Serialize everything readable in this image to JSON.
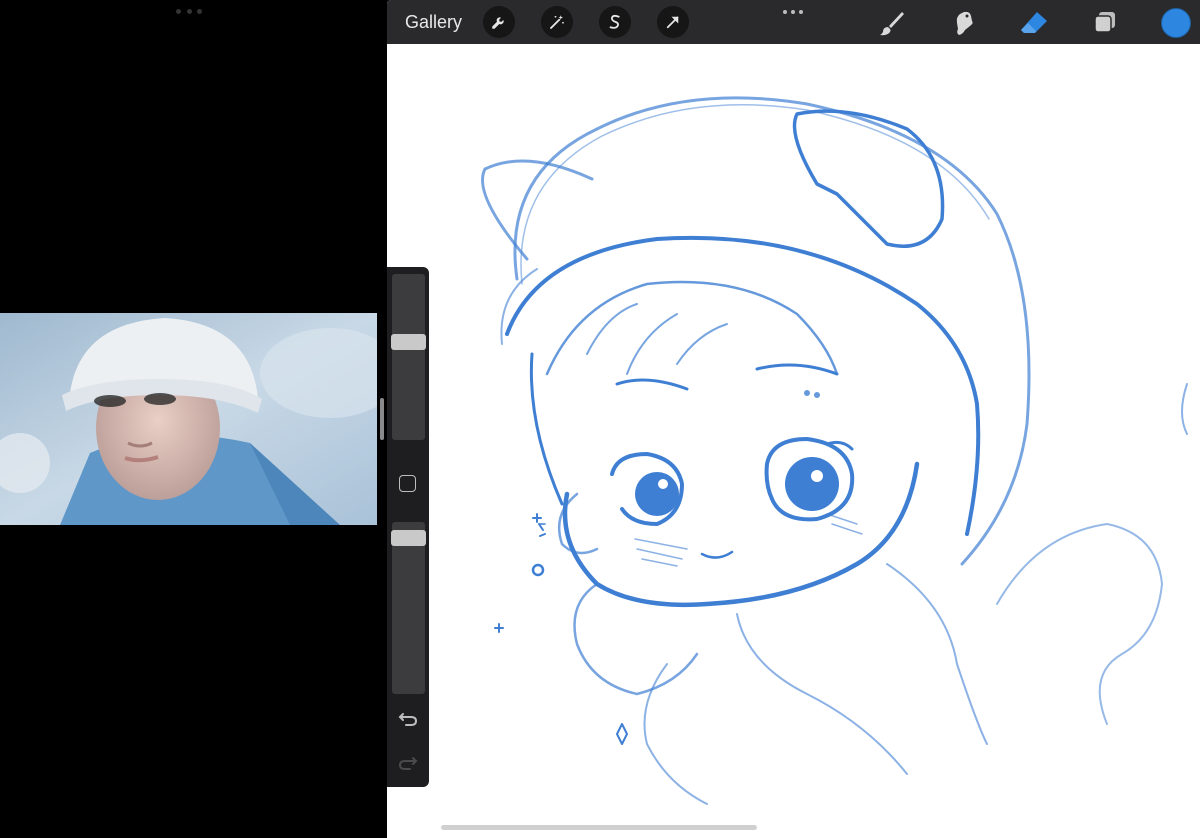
{
  "toolbar": {
    "gallery_label": "Gallery",
    "tools_left": [
      "wrench-icon",
      "magic-wand-icon",
      "selection-icon",
      "transform-arrow-icon"
    ],
    "tools_right": [
      "brush-icon",
      "smudge-icon",
      "eraser-icon",
      "layers-icon"
    ],
    "active_tool": "eraser-icon",
    "current_color": "#2d86e0"
  },
  "sidebar": {
    "brush_size_fraction": 0.6,
    "opacity_fraction": 0.95
  },
  "colors": {
    "sketch_blue": "#3f7fd3",
    "canvas_background": "#ffffff",
    "toolbar_background": "#2a2a2c"
  }
}
